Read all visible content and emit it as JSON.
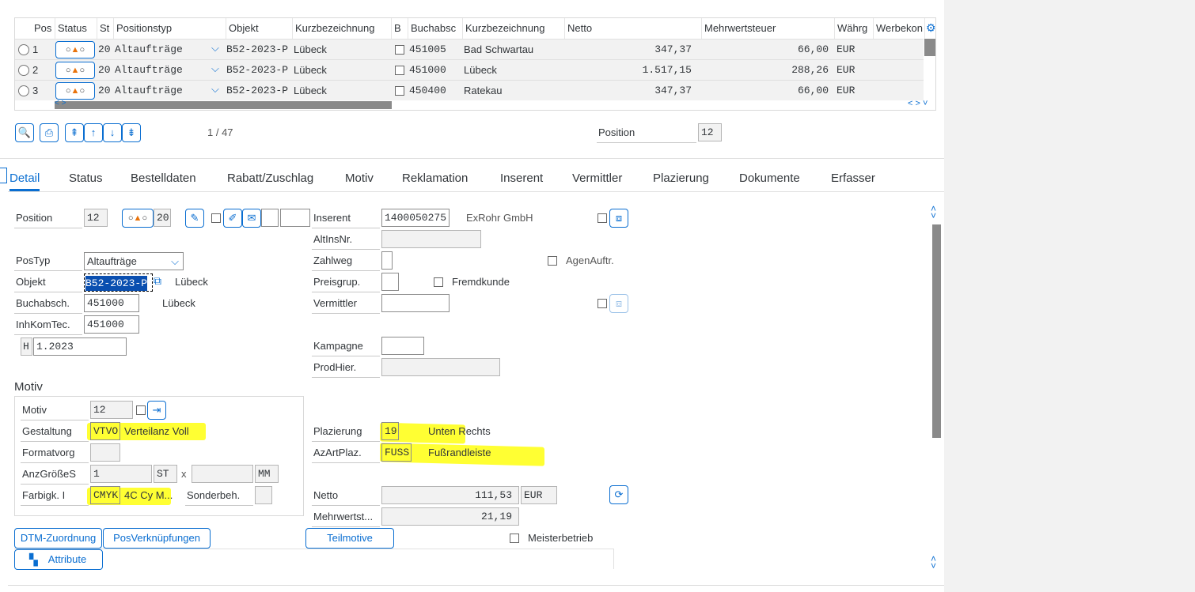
{
  "table": {
    "headers": [
      "Pos",
      "Status",
      "St",
      "Positionstyp",
      "Objekt",
      "Kurzbezeichnung",
      "B",
      "Buchabsc",
      "Kurzbezeichnung",
      "Netto",
      "Mehrwertsteuer",
      "Währg",
      "Werbekon"
    ],
    "rows": [
      {
        "pos": "1",
        "st": "20",
        "typ": "Altaufträge",
        "objekt": "B52-2023-P",
        "kurz": "Lübeck",
        "buch": "451005",
        "kurz2": "Bad Schwartau",
        "netto": "347,37",
        "mwst": "66,00",
        "waehrg": "EUR"
      },
      {
        "pos": "2",
        "st": "20",
        "typ": "Altaufträge",
        "objekt": "B52-2023-P",
        "kurz": "Lübeck",
        "buch": "451000",
        "kurz2": "Lübeck",
        "netto": "1.517,15",
        "mwst": "288,26",
        "waehrg": "EUR"
      },
      {
        "pos": "3",
        "st": "20",
        "typ": "Altaufträge",
        "objekt": "B52-2023-P",
        "kurz": "Lübeck",
        "buch": "450400",
        "kurz2": "Ratekau",
        "netto": "347,37",
        "mwst": "66,00",
        "waehrg": "EUR"
      }
    ]
  },
  "toolbar": {
    "page": "1 / 47",
    "position_label": "Position",
    "position_value": "12"
  },
  "tabs": [
    "Detail",
    "Status",
    "Bestelldaten",
    "Rabatt/Zuschlag",
    "Motiv",
    "Reklamation",
    "Inserent",
    "Vermittler",
    "Plazierung",
    "Dokumente",
    "Erfasser"
  ],
  "detail": {
    "position_label": "Position",
    "position_value": "12",
    "status_value": "20",
    "postyp_label": "PosTyp",
    "postyp_value": "Altaufträge",
    "objekt_label": "Objekt",
    "objekt_value": "B52-2023-P",
    "objekt_text": "Lübeck",
    "buchabsch_label": "Buchabsch.",
    "buchabsch_value": "451000",
    "buchabsch_text": "Lübeck",
    "inhkom_label": "InhKomTec.",
    "inhkom_value": "451000",
    "h_value": "H",
    "period_value": "1.2023",
    "inserent_label": "Inserent",
    "inserent_value": "1400050275",
    "inserent_name": "ExRohr GmbH",
    "altins_label": "AltInsNr.",
    "zahlweg_label": "Zahlweg",
    "agenauftr_label": "AgenAuftr.",
    "preisgrup_label": "Preisgrup.",
    "fremdkunde_label": "Fremdkunde",
    "vermittler_label": "Vermittler",
    "kampagne_label": "Kampagne",
    "prodhier_label": "ProdHier."
  },
  "motiv": {
    "section_title": "Motiv",
    "motiv_label": "Motiv",
    "motiv_value": "12",
    "gestaltung_label": "Gestaltung",
    "gestaltung_code": "VTVO",
    "gestaltung_text": "Verteilanz Voll",
    "formatvorg_label": "Formatvorg",
    "anzgroesse_label": "AnzGrößeS",
    "anz_value": "1",
    "anz_unit": "ST",
    "x_label": "x",
    "mm_unit": "MM",
    "farbigk_label": "Farbigk. I",
    "farbigk_code": "CMYK",
    "farbigk_text": "4C Cy M...",
    "sonderbeh_label": "Sonderbeh."
  },
  "plazierung": {
    "plazierung_label": "Plazierung",
    "plazierung_code": "19",
    "plazierung_text": "Unten Rechts",
    "azart_label": "AzArtPlaz.",
    "azart_code": "FUSS",
    "azart_text": "Fußrandleiste",
    "netto_label": "Netto",
    "netto_value": "111,53",
    "netto_currency": "EUR",
    "mwst_label": "Mehrwertst...",
    "mwst_value": "21,19",
    "meisterbetrieb_label": "Meisterbetrieb"
  },
  "buttons": {
    "dtm": "DTM-Zuordnung",
    "posverk": "PosVerknüpfungen",
    "teilmotive": "Teilmotive",
    "attribute": "Attribute"
  },
  "colors": {
    "accent": "#0a6ed1",
    "highlight": "#ffff33",
    "status_warning": "#e9730c"
  }
}
